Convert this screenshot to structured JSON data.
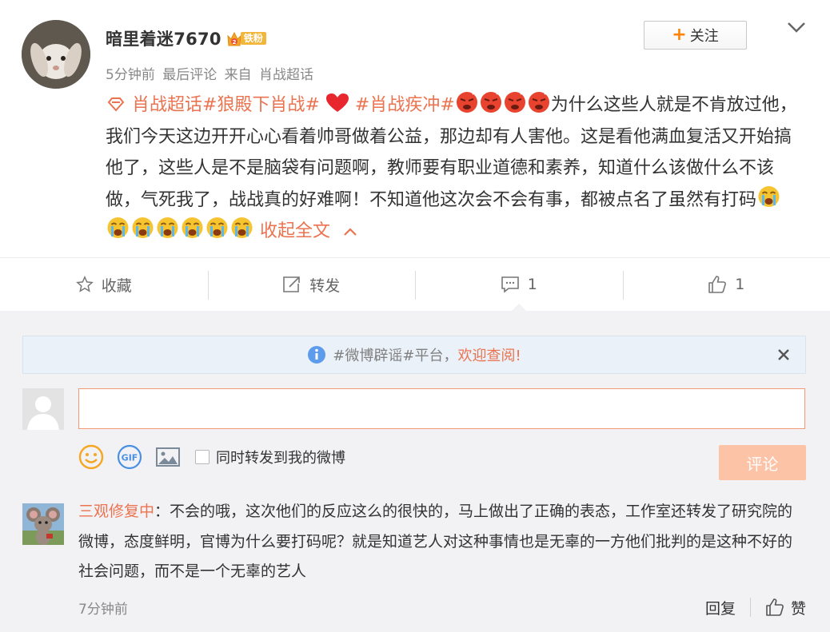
{
  "post": {
    "username": "暗里着迷7670",
    "fan_level": "2",
    "fan_badge": "铁粉",
    "time": "5分钟前",
    "last_comment": "最后评论",
    "source_prefix": "来自",
    "source": "肖战超话",
    "follow_label": "关注",
    "topic_supertopic": "肖战超话",
    "topic_1": "#狼殿下肖战#",
    "topic_2": "#肖战疾冲#",
    "body_text": "为什么这些人就是不肯放过他，我们今天这边开开心心看着帅哥做着公益，那边却有人害他。这是看他满血复活又开始搞他了，这些人是不是脑袋有问题啊，教师要有职业道德和素养，知道什么该做什么不该做，气死我了，战战真的好难啊！不知道他这次会不会有事，都被点名了虽然有打码",
    "collapse_label": "收起全文",
    "icons": [
      "diamond-topic-icon",
      "red-heart-icon",
      "angry-face-icon",
      "crying-face-icon",
      "chevron-up-icon"
    ]
  },
  "actions": {
    "favorite_label": "收藏",
    "repost_label": "转发",
    "comment_count": "1",
    "like_count": "1"
  },
  "comments": {
    "notice_topic": "#微博辟谣#平台，",
    "notice_link": "欢迎查阅!",
    "input_value": "",
    "repost_option": "同时转发到我的微博",
    "submit_label": "评论",
    "reply": {
      "user": "三观修复中",
      "text": "：不会的哦，这次他们的反应这么的很快的，马上做出了正确的表态，工作室还转发了研究院的微博，态度鲜明，官博为什么要打码呢？就是知道艺人对这种事情也是无辜的一方他们批判的是这种不好的社会问题，而不是一个无辜的艺人",
      "time": "7分钟前",
      "reply_label": "回复",
      "like_label": "赞"
    }
  },
  "colors": {
    "accent_orange": "#ff8200",
    "topic_color": "#eb7350",
    "submit_disabled": "#fdc3a6",
    "notice_bg": "#eaf1f8"
  }
}
